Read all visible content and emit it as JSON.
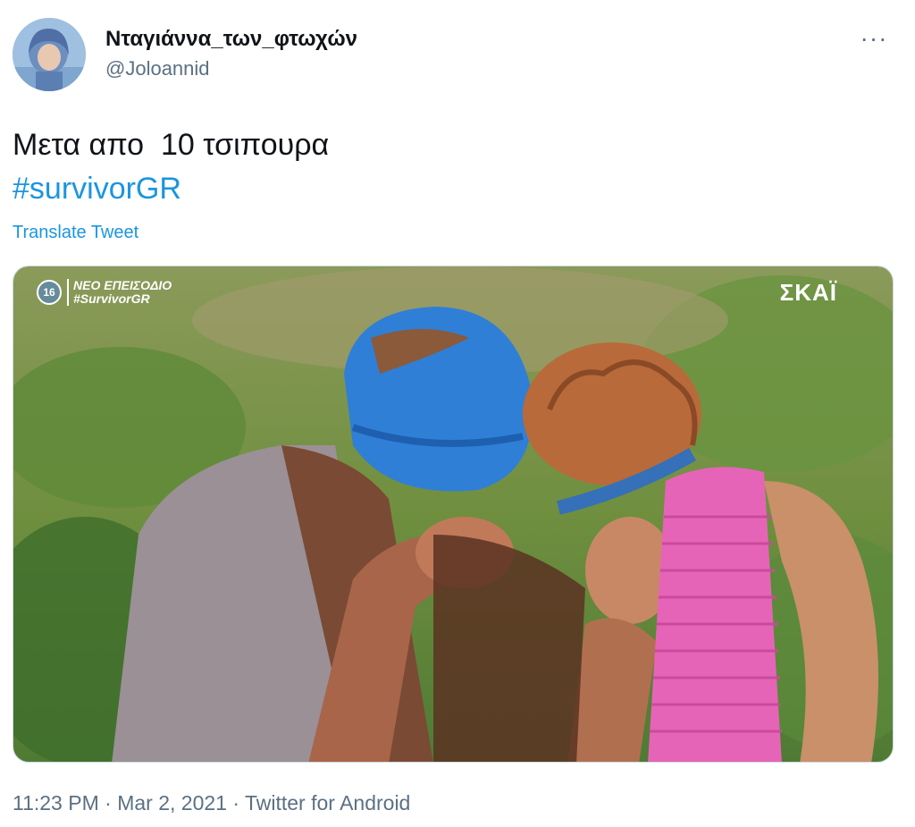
{
  "author": {
    "display_name": "Νταγιάννα_των_φτωχών",
    "handle": "@Joloannid"
  },
  "menu": {
    "more_icon": "more-horizontal-icon",
    "glyph": "···"
  },
  "tweet": {
    "text": "Μετα απο  10 τσιπουρα",
    "hashtag": "#survivorGR",
    "translate_label": "Translate Tweet"
  },
  "media": {
    "channel_number": "16",
    "overlay_line1": "ΝΕΟ ΕΠΕΙΣΟΔΙΟ",
    "overlay_line2": "#SurvivorGR",
    "channel_logo": "ΣΚΑΪ"
  },
  "meta": {
    "time": "11:23 PM",
    "separator": " · ",
    "date": "Mar 2, 2021",
    "source": "Twitter for Android"
  },
  "colors": {
    "link": "#1b95e0",
    "secondary_text": "#5b7083",
    "primary_text": "#0f1419"
  }
}
